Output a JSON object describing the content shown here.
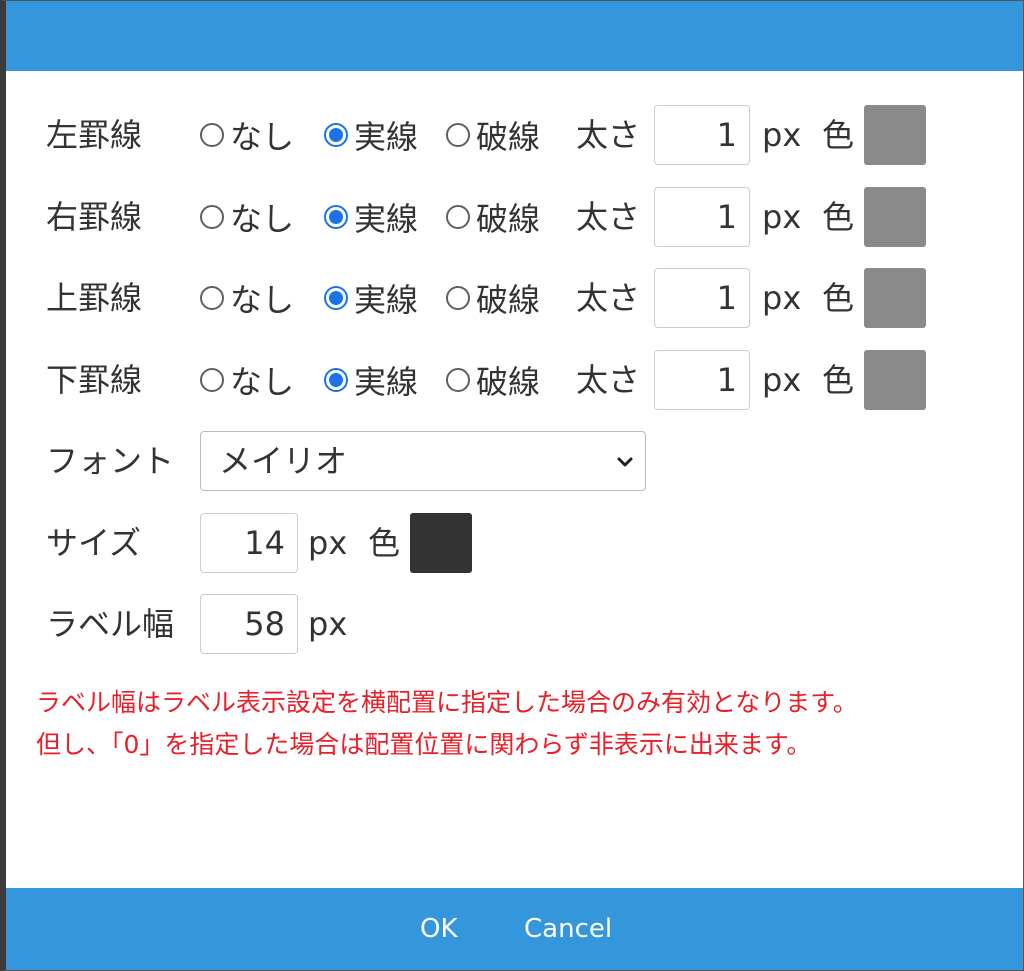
{
  "borders": [
    {
      "label": "左罫線",
      "options": [
        "なし",
        "実線",
        "破線"
      ],
      "selected": 1,
      "width_label": "太さ",
      "width_value": "1",
      "unit": "px",
      "color_label": "色",
      "color": "#8a8a8a"
    },
    {
      "label": "右罫線",
      "options": [
        "なし",
        "実線",
        "破線"
      ],
      "selected": 1,
      "width_label": "太さ",
      "width_value": "1",
      "unit": "px",
      "color_label": "色",
      "color": "#8a8a8a"
    },
    {
      "label": "上罫線",
      "options": [
        "なし",
        "実線",
        "破線"
      ],
      "selected": 1,
      "width_label": "太さ",
      "width_value": "1",
      "unit": "px",
      "color_label": "色",
      "color": "#8a8a8a"
    },
    {
      "label": "下罫線",
      "options": [
        "なし",
        "実線",
        "破線"
      ],
      "selected": 1,
      "width_label": "太さ",
      "width_value": "1",
      "unit": "px",
      "color_label": "色",
      "color": "#8a8a8a"
    }
  ],
  "font": {
    "label": "フォント",
    "selected": "メイリオ"
  },
  "size": {
    "label": "サイズ",
    "value": "14",
    "unit": "px",
    "color_label": "色",
    "color": "#333333"
  },
  "label_width": {
    "label": "ラベル幅",
    "value": "58",
    "unit": "px"
  },
  "notes": [
    "ラベル幅はラベル表示設定を横配置に指定した場合のみ有効となります。",
    "但し、「0」を指定した場合は配置位置に関わらず非表示に出来ます。"
  ],
  "footer": {
    "ok_label": "OK",
    "cancel_label": "Cancel"
  },
  "theme": {
    "accent": "#3496db",
    "radio": "#1a73e8",
    "note": "#e8202a"
  }
}
